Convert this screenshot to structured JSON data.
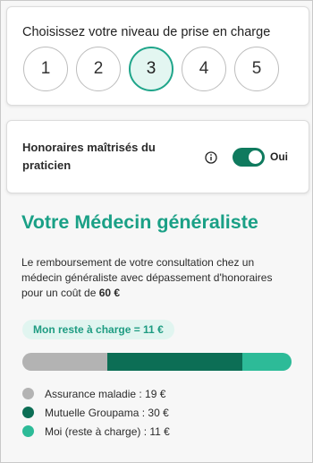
{
  "level_selector": {
    "title": "Choisissez votre niveau de prise en charge",
    "levels": [
      "1",
      "2",
      "3",
      "4",
      "5"
    ],
    "selected": "3"
  },
  "fees_control": {
    "label": "Honoraires maîtrisés du praticien",
    "info_icon": "info-icon",
    "toggle_on": true,
    "toggle_label": "Oui"
  },
  "result": {
    "title": "Votre Médecin généraliste",
    "description": "Le remboursement de votre consultation chez un médecin généraliste avec dépassement d'honoraires pour un coût de",
    "amount": "60 €",
    "remaining_pill": "Mon reste à charge = 11 €"
  },
  "breakdown": {
    "total": 60,
    "segments": [
      {
        "label": "Assurance maladie : 19 €",
        "value": 19,
        "color": "#b3b3b3"
      },
      {
        "label": "Mutuelle Groupama : 30 €",
        "value": 30,
        "color": "#0c6e55"
      },
      {
        "label": "Moi (reste à charge) : 11 €",
        "value": 11,
        "color": "#2dbb98"
      }
    ]
  },
  "colors": {
    "accent": "#1aa086",
    "dark_green": "#0c6e55",
    "light_green": "#2dbb98",
    "gray": "#b3b3b3"
  }
}
